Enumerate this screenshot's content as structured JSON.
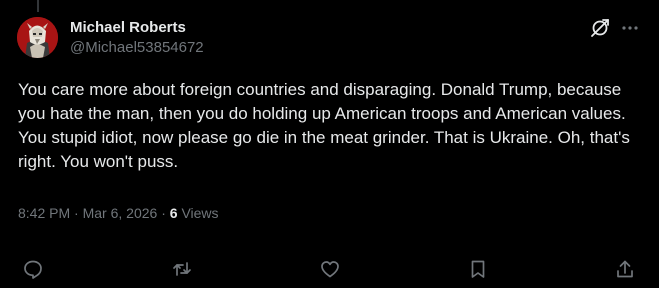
{
  "tweet": {
    "author": {
      "display_name": "Michael Roberts",
      "handle": "@Michael53854672"
    },
    "text": "You care more about foreign countries and disparaging. Donald Trump, because you hate the man, then you do holding up American troops and American values. You stupid idiot, now please go die in the meat grinder. That is Ukraine. Oh, that's right. You won't puss.",
    "time": "8:42 PM",
    "separator": "·",
    "date": "Mar 6, 2026",
    "views_count": "6",
    "views_label": "Views"
  },
  "icons": {
    "header": [
      "grok-icon",
      "more-icon"
    ],
    "actions": [
      "reply-icon",
      "repost-icon",
      "like-icon",
      "bookmark-icon",
      "share-icon"
    ]
  },
  "colors": {
    "background": "#000000",
    "text_primary": "#e7e9ea",
    "text_secondary": "#71767b",
    "avatar_bg": "#b01818"
  }
}
